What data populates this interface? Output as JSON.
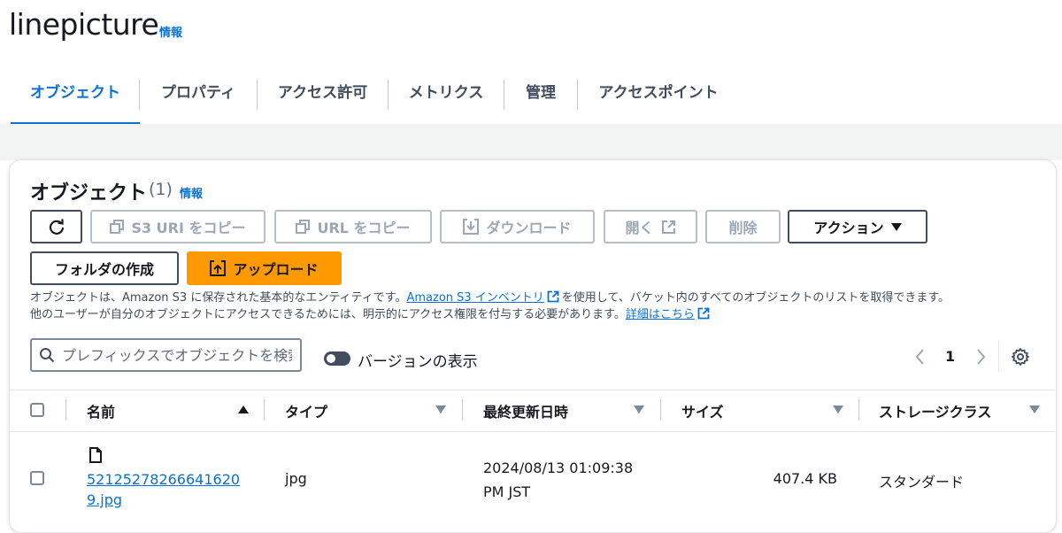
{
  "bucket": {
    "name": "linepicture",
    "info_label": "情報"
  },
  "tabs": [
    {
      "label": "オブジェクト",
      "active": true
    },
    {
      "label": "プロパティ"
    },
    {
      "label": "アクセス許可"
    },
    {
      "label": "メトリクス"
    },
    {
      "label": "管理"
    },
    {
      "label": "アクセスポイント"
    }
  ],
  "objects_panel": {
    "heading": "オブジェクト",
    "count": "(1)",
    "info_label": "情報",
    "toolbar": {
      "copy_s3_uri": "S3 URI をコピー",
      "copy_url": "URL をコピー",
      "download": "ダウンロード",
      "open": "開く",
      "delete": "削除",
      "actions": "アクション",
      "create_folder": "フォルダの作成",
      "upload": "アップロード"
    },
    "description": {
      "line1_pre": "オブジェクトは、Amazon S3 に保存された基本的なエンティティです。",
      "inventory_link": "Amazon S3 インベントリ",
      "line1_post": "を使用して、バケット内のすべてのオブジェクトのリストを取得できます。",
      "line2_pre": "他のユーザーが自分のオブジェクトにアクセスできるためには、明示的にアクセス権限を付与する必要があります。",
      "details_link": "詳細はこちら"
    },
    "search": {
      "placeholder": "プレフィックスでオブジェクトを検索"
    },
    "versions_toggle_label": "バージョンの表示",
    "pagination": {
      "current_page": "1"
    },
    "table": {
      "columns": [
        "名前",
        "タイプ",
        "最終更新日時",
        "サイズ",
        "ストレージクラス"
      ],
      "rows": [
        {
          "name": "521252782666416209.jpg",
          "type": "jpg",
          "modified": "2024/08/13 01:09:38 PM JST",
          "size": "407.4 KB",
          "storage_class": "スタンダード"
        }
      ]
    }
  },
  "colors": {
    "link": "#0972d3",
    "primary_button": "#ff9900",
    "text": "#16191f",
    "disabled": "#9ba7b6"
  }
}
